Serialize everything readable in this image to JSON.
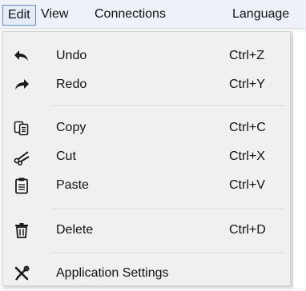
{
  "menubar": {
    "items": [
      {
        "label": "Edit",
        "active": true
      },
      {
        "label": "View"
      },
      {
        "label": "Connections"
      },
      {
        "label": "Language"
      }
    ]
  },
  "edit_menu": {
    "items": [
      {
        "icon": "undo-icon",
        "label": "Undo",
        "shortcut": "Ctrl+Z"
      },
      {
        "icon": "redo-icon",
        "label": "Redo",
        "shortcut": "Ctrl+Y"
      },
      {
        "icon": "copy-icon",
        "label": "Copy",
        "shortcut": "Ctrl+C"
      },
      {
        "icon": "cut-icon",
        "label": "Cut",
        "shortcut": "Ctrl+X"
      },
      {
        "icon": "paste-icon",
        "label": "Paste",
        "shortcut": "Ctrl+V"
      },
      {
        "icon": "delete-icon",
        "label": "Delete",
        "shortcut": "Ctrl+D"
      },
      {
        "icon": "settings-icon",
        "label": "Application Settings",
        "shortcut": ""
      }
    ]
  },
  "colors": {
    "menubar_bg": "#eef2f8",
    "menu_bg": "#f0f0f0",
    "active_border": "#6a8ab8"
  }
}
